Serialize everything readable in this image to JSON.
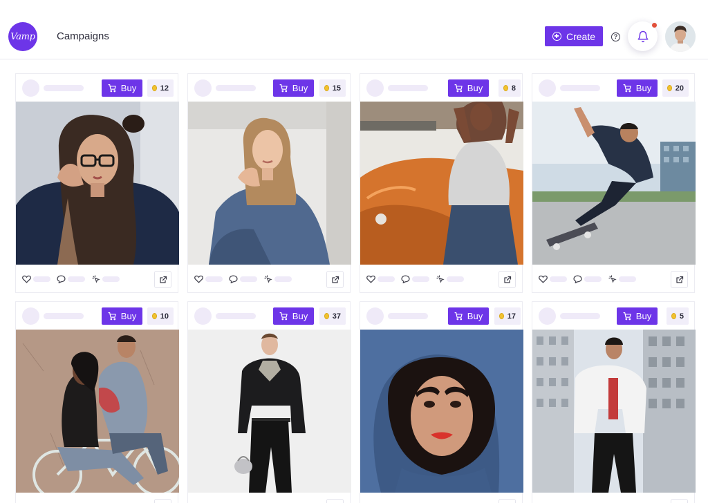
{
  "window": {
    "controls": [
      "close",
      "minimize",
      "maximize"
    ],
    "colors": [
      "#ee6a5f",
      "#f5bd4f",
      "#61c454"
    ]
  },
  "header": {
    "logo_text": "Vamp",
    "title": "Campaigns",
    "create_label": "Create",
    "icons": {
      "help": "help-circle-icon",
      "notifications": "bell-icon",
      "user": "avatar"
    }
  },
  "brand": {
    "accent": "#6d35e8",
    "placeholder": "#efeaf8",
    "coin": "#f2c230",
    "notification_dot": "#e1503a"
  },
  "cards": [
    {
      "buy_label": "Buy",
      "coins": "12",
      "photo": "woman with glasses, long hair, navy jacket"
    },
    {
      "buy_label": "Buy",
      "coins": "15",
      "photo": "blonde woman in denim jacket sitting"
    },
    {
      "buy_label": "Buy",
      "coins": "8",
      "photo": "woman in grey tee leaning on orange car"
    },
    {
      "buy_label": "Buy",
      "coins": "20",
      "photo": "skateboarder jumping near building"
    },
    {
      "buy_label": "Buy",
      "coins": "10",
      "photo": "couple on a bicycle"
    },
    {
      "buy_label": "Buy",
      "coins": "37",
      "photo": "man in black outfit holding silver bag"
    },
    {
      "buy_label": "Buy",
      "coins": "17",
      "photo": "woman with red lipstick in denim hood"
    },
    {
      "buy_label": "Buy",
      "coins": "5",
      "photo": "man in white jacket between buildings"
    }
  ]
}
